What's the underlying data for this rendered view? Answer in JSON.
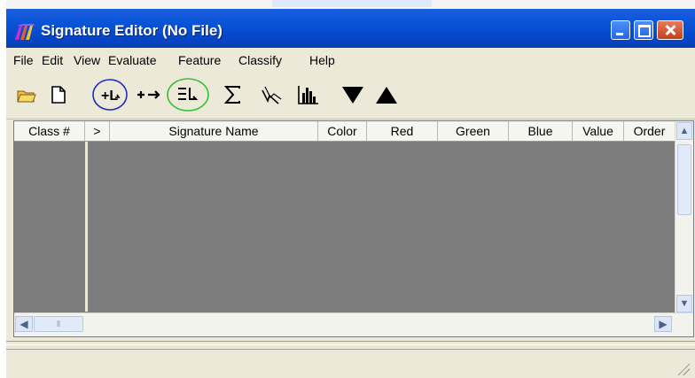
{
  "window": {
    "title": "Signature Editor (No File)"
  },
  "menu": [
    "File",
    "Edit",
    "View",
    "Evaluate",
    "Feature",
    "Classify",
    "Help"
  ],
  "toolbar": {
    "tools": [
      {
        "icon": "open-folder-icon",
        "glyph": "📂"
      },
      {
        "icon": "new-file-icon",
        "glyph": "🗋"
      },
      {
        "icon": "add-signature-icon",
        "glyph": "+L"
      },
      {
        "icon": "replace-signature-icon",
        "glyph": "+→"
      },
      {
        "icon": "merge-signatures-icon",
        "glyph": "≡L"
      },
      {
        "icon": "sigma-statistics-icon",
        "glyph": "Σ"
      },
      {
        "icon": "mean-plot-icon",
        "glyph": "⋋"
      },
      {
        "icon": "histogram-icon",
        "glyph": "📊"
      },
      {
        "icon": "move-down-icon",
        "glyph": "▼"
      },
      {
        "icon": "move-up-icon",
        "glyph": "▲"
      }
    ],
    "highlight_colors": {
      "add": "#1f2dbd",
      "merge": "#36c236"
    }
  },
  "table": {
    "columns": [
      "Class #",
      ">",
      "Signature Name",
      "Color",
      "Red",
      "Green",
      "Blue",
      "Value",
      "Order"
    ],
    "rows": []
  },
  "colors": {
    "title_bar": "#0a55d8",
    "grid_background": "#7d7d7d",
    "chrome": "#ece9d8"
  }
}
